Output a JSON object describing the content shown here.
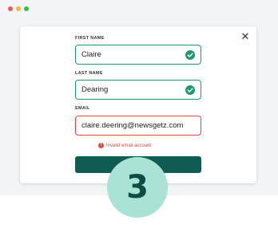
{
  "window": {
    "controls": [
      "close",
      "minimize",
      "maximize"
    ]
  },
  "form": {
    "close_label": "✕",
    "first_name": {
      "label": "FIRST NAME",
      "value": "Claire",
      "status": "valid"
    },
    "last_name": {
      "label": "LAST NAME",
      "value": "Dearing",
      "status": "valid"
    },
    "email": {
      "label": "EMAIL",
      "value": "claire.deering@newsgetz.com",
      "status": "invalid",
      "error": "Invalid email account"
    },
    "submit_label": ""
  },
  "step_badge": "3",
  "colors": {
    "valid": "#1c9a6c",
    "error": "#e0453f",
    "button": "#0f5d52",
    "badge_bg": "#a9e3d6",
    "badge_text": "#114b45"
  },
  "icons": {
    "valid": "check-circle-icon",
    "error": "alert-circle-icon",
    "close": "close-icon"
  }
}
